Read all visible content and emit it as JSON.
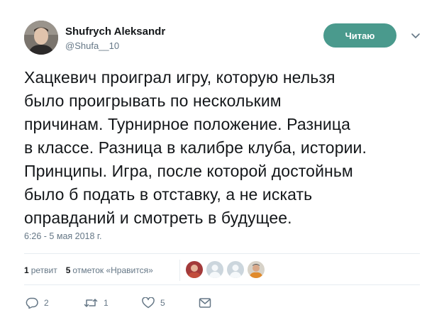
{
  "author": {
    "name": "Shufrych Aleksandr",
    "handle": "@Shufa__10"
  },
  "follow_button": {
    "label": "Читаю",
    "color": "#4a9a8d"
  },
  "tweet": {
    "lines": [
      "Хацкевич проиграл игру, которую нельзя",
      "было проигрывать по нескольким",
      "причинам. Турнирное положение. Разница",
      "в классе. Разница в калибре клуба, истории.",
      "Принципы. Игра, после которой достойньм",
      "было б подать в отставку, а не искать",
      "оправданий и смотреть в будущее."
    ],
    "timestamp": "6:26 - 5 мая 2018 г."
  },
  "stats": {
    "retweets_count": "1",
    "retweets_label": "ретвит",
    "likes_count": "5",
    "likes_label": "отметок «Нравится»"
  },
  "actions": {
    "reply_count": "2",
    "retweet_count": "1",
    "like_count": "5"
  },
  "icons": [
    "caret-down-icon",
    "reply-icon",
    "retweet-icon",
    "heart-icon",
    "message-icon"
  ]
}
